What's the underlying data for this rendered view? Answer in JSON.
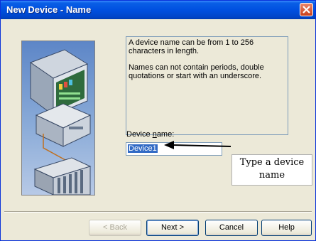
{
  "window": {
    "title": "New Device - Name"
  },
  "info": {
    "line1": "A device name can be from 1 to 256 characters in length.",
    "line2": "Names can not contain periods, double quotations or start with an underscore."
  },
  "field": {
    "label_pre": "Device ",
    "label_accel": "n",
    "label_post": "ame:",
    "value": "Device1"
  },
  "callout": {
    "text": "Type a device name"
  },
  "buttons": {
    "back": "< Back",
    "next": "Next >",
    "cancel": "Cancel",
    "help": "Help"
  },
  "colors": {
    "titlebar": "#0050e0",
    "selection": "#316ac5",
    "face": "#ece9d8",
    "close": "#c8401b"
  }
}
